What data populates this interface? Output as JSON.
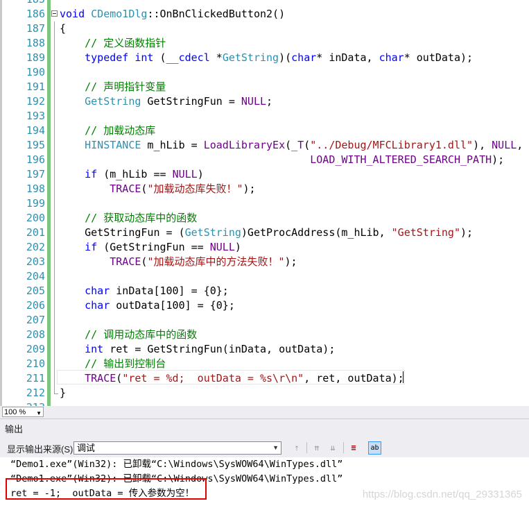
{
  "editor": {
    "lines": [
      {
        "num": "185",
        "segs": []
      },
      {
        "num": "186",
        "segs": [
          [
            "kw",
            "void "
          ],
          [
            "ty",
            "CDemo1Dlg"
          ],
          [
            "pl",
            "::OnBnClickedButton2()"
          ]
        ]
      },
      {
        "num": "187",
        "segs": [
          [
            "pl",
            "{"
          ]
        ]
      },
      {
        "num": "188",
        "segs": [
          [
            "pl",
            "    "
          ],
          [
            "cm",
            "// 定义函数指针"
          ]
        ]
      },
      {
        "num": "189",
        "segs": [
          [
            "pl",
            "    "
          ],
          [
            "kw",
            "typedef int "
          ],
          [
            "pl",
            "("
          ],
          [
            "kw",
            "__cdecl "
          ],
          [
            "pl",
            "*"
          ],
          [
            "ty",
            "GetString"
          ],
          [
            "pl",
            ")("
          ],
          [
            "kw",
            "char"
          ],
          [
            "pl",
            "* inData, "
          ],
          [
            "kw",
            "char"
          ],
          [
            "pl",
            "* outData);"
          ]
        ]
      },
      {
        "num": "190",
        "segs": []
      },
      {
        "num": "191",
        "segs": [
          [
            "pl",
            "    "
          ],
          [
            "cm",
            "// 声明指针变量"
          ]
        ]
      },
      {
        "num": "192",
        "segs": [
          [
            "pl",
            "    "
          ],
          [
            "ty",
            "GetString"
          ],
          [
            "pl",
            " GetStringFun = "
          ],
          [
            "mac",
            "NULL"
          ],
          [
            "pl",
            ";"
          ]
        ]
      },
      {
        "num": "193",
        "segs": []
      },
      {
        "num": "194",
        "segs": [
          [
            "pl",
            "    "
          ],
          [
            "cm",
            "// 加载动态库"
          ]
        ]
      },
      {
        "num": "195",
        "segs": [
          [
            "pl",
            "    "
          ],
          [
            "ty",
            "HINSTANCE"
          ],
          [
            "pl",
            " m_hLib = "
          ],
          [
            "mac",
            "LoadLibraryEx"
          ],
          [
            "pl",
            "("
          ],
          [
            "mac",
            "_T"
          ],
          [
            "pl",
            "("
          ],
          [
            "st",
            "\"../Debug/MFCLibrary1.dll\""
          ],
          [
            "pl",
            "), "
          ],
          [
            "mac",
            "NULL"
          ],
          [
            "pl",
            ","
          ]
        ]
      },
      {
        "num": "196",
        "segs": [
          [
            "pl",
            "                                        "
          ],
          [
            "mac",
            "LOAD_WITH_ALTERED_SEARCH_PATH"
          ],
          [
            "pl",
            ");"
          ]
        ]
      },
      {
        "num": "197",
        "segs": [
          [
            "pl",
            "    "
          ],
          [
            "kw",
            "if "
          ],
          [
            "pl",
            "(m_hLib == "
          ],
          [
            "mac",
            "NULL"
          ],
          [
            "pl",
            ")"
          ]
        ]
      },
      {
        "num": "198",
        "segs": [
          [
            "pl",
            "        "
          ],
          [
            "mac",
            "TRACE"
          ],
          [
            "pl",
            "("
          ],
          [
            "st",
            "\"加载动态库失败！\""
          ],
          [
            "pl",
            ");"
          ]
        ]
      },
      {
        "num": "199",
        "segs": []
      },
      {
        "num": "200",
        "segs": [
          [
            "pl",
            "    "
          ],
          [
            "cm",
            "// 获取动态库中的函数"
          ]
        ]
      },
      {
        "num": "201",
        "segs": [
          [
            "pl",
            "    GetStringFun = ("
          ],
          [
            "ty",
            "GetString"
          ],
          [
            "pl",
            ")GetProcAddress(m_hLib, "
          ],
          [
            "st",
            "\"GetString\""
          ],
          [
            "pl",
            ");"
          ]
        ]
      },
      {
        "num": "202",
        "segs": [
          [
            "pl",
            "    "
          ],
          [
            "kw",
            "if "
          ],
          [
            "pl",
            "(GetStringFun == "
          ],
          [
            "mac",
            "NULL"
          ],
          [
            "pl",
            ")"
          ]
        ]
      },
      {
        "num": "203",
        "segs": [
          [
            "pl",
            "        "
          ],
          [
            "mac",
            "TRACE"
          ],
          [
            "pl",
            "("
          ],
          [
            "st",
            "\"加载动态库中的方法失败！\""
          ],
          [
            "pl",
            ");"
          ]
        ]
      },
      {
        "num": "204",
        "segs": []
      },
      {
        "num": "205",
        "segs": [
          [
            "pl",
            "    "
          ],
          [
            "kw",
            "char "
          ],
          [
            "pl",
            "inData[100] = {0};"
          ]
        ]
      },
      {
        "num": "206",
        "segs": [
          [
            "pl",
            "    "
          ],
          [
            "kw",
            "char "
          ],
          [
            "pl",
            "outData[100] = {0};"
          ]
        ]
      },
      {
        "num": "207",
        "segs": []
      },
      {
        "num": "208",
        "segs": [
          [
            "pl",
            "    "
          ],
          [
            "cm",
            "// 调用动态库中的函数"
          ]
        ]
      },
      {
        "num": "209",
        "segs": [
          [
            "pl",
            "    "
          ],
          [
            "kw",
            "int "
          ],
          [
            "pl",
            "ret = GetStringFun(inData, outData);"
          ]
        ]
      },
      {
        "num": "210",
        "segs": [
          [
            "pl",
            "    "
          ],
          [
            "cm",
            "// 输出到控制台"
          ]
        ]
      },
      {
        "num": "211",
        "segs": [
          [
            "pl",
            "    "
          ],
          [
            "mac",
            "TRACE"
          ],
          [
            "pl",
            "("
          ],
          [
            "st",
            "\"ret = %d;  outData = %s\\r\\n\""
          ],
          [
            "pl",
            ", ret, outData);"
          ]
        ]
      },
      {
        "num": "212",
        "segs": [
          [
            "pl",
            "}"
          ]
        ]
      },
      {
        "num": "213",
        "segs": []
      }
    ]
  },
  "zoom": {
    "value": "100 %"
  },
  "output": {
    "title": "输出",
    "source_label": "显示输出来源(S):",
    "source_value": "调试",
    "lines": [
      "“Demo1.exe”(Win32): 已卸载“C:\\Windows\\SysWOW64\\WinTypes.dll”",
      "“Demo1.exe”(Win32): 已卸载“C:\\Windows\\SysWOW64\\WinTypes.dll”",
      "ret = -1;  outData = 传入参数为空！"
    ],
    "watermark": "https://blog.csdn.net/qq_29331365"
  }
}
